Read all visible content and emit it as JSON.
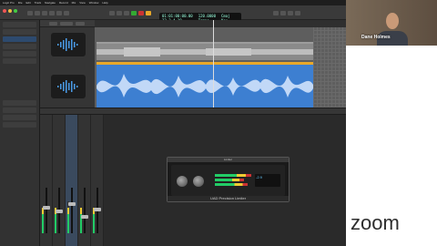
{
  "app": {
    "menu_items": [
      "Logic Pro",
      "File",
      "Edit",
      "Track",
      "Navigate",
      "Record",
      "Mix",
      "View",
      "Window",
      "Help"
    ],
    "lcd": {
      "position_top": "01:01:00:00.00",
      "position_bottom": "32 3 4 10",
      "tempo_value": "120.0000",
      "tempo_label": "Tempo",
      "key_value": "Cmaj",
      "key_label": "Key"
    }
  },
  "tracks": {
    "header_buttons": [
      "Edit",
      "Functions",
      "View"
    ]
  },
  "plugin": {
    "window_title": "Limiter",
    "name": "UAD Precision Limiter",
    "knob_value": "-2.9"
  },
  "video": {
    "participant_name": "Dane Holmes"
  },
  "zoom": {
    "logo_text": "zoom"
  },
  "colors": {
    "region_blue": "#3d7fd1",
    "region_top": "#e8a82a",
    "zoom_logo": "#2d2d2d"
  }
}
